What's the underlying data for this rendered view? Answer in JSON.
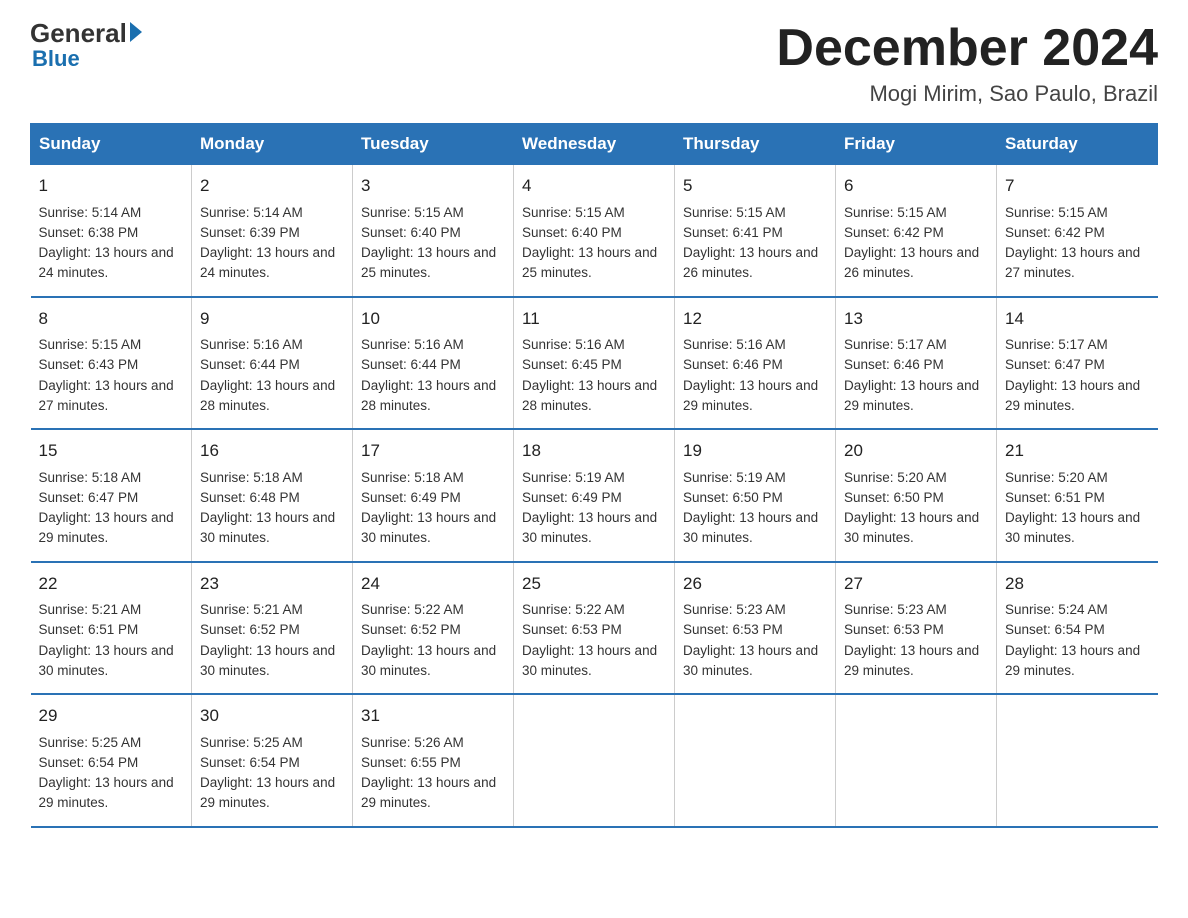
{
  "header": {
    "logo": {
      "general": "General",
      "blue": "Blue",
      "tagline": "Blue"
    },
    "title": "December 2024",
    "subtitle": "Mogi Mirim, Sao Paulo, Brazil"
  },
  "columns": [
    "Sunday",
    "Monday",
    "Tuesday",
    "Wednesday",
    "Thursday",
    "Friday",
    "Saturday"
  ],
  "weeks": [
    [
      {
        "day": "1",
        "sunrise": "5:14 AM",
        "sunset": "6:38 PM",
        "daylight": "13 hours and 24 minutes."
      },
      {
        "day": "2",
        "sunrise": "5:14 AM",
        "sunset": "6:39 PM",
        "daylight": "13 hours and 24 minutes."
      },
      {
        "day": "3",
        "sunrise": "5:15 AM",
        "sunset": "6:40 PM",
        "daylight": "13 hours and 25 minutes."
      },
      {
        "day": "4",
        "sunrise": "5:15 AM",
        "sunset": "6:40 PM",
        "daylight": "13 hours and 25 minutes."
      },
      {
        "day": "5",
        "sunrise": "5:15 AM",
        "sunset": "6:41 PM",
        "daylight": "13 hours and 26 minutes."
      },
      {
        "day": "6",
        "sunrise": "5:15 AM",
        "sunset": "6:42 PM",
        "daylight": "13 hours and 26 minutes."
      },
      {
        "day": "7",
        "sunrise": "5:15 AM",
        "sunset": "6:42 PM",
        "daylight": "13 hours and 27 minutes."
      }
    ],
    [
      {
        "day": "8",
        "sunrise": "5:15 AM",
        "sunset": "6:43 PM",
        "daylight": "13 hours and 27 minutes."
      },
      {
        "day": "9",
        "sunrise": "5:16 AM",
        "sunset": "6:44 PM",
        "daylight": "13 hours and 28 minutes."
      },
      {
        "day": "10",
        "sunrise": "5:16 AM",
        "sunset": "6:44 PM",
        "daylight": "13 hours and 28 minutes."
      },
      {
        "day": "11",
        "sunrise": "5:16 AM",
        "sunset": "6:45 PM",
        "daylight": "13 hours and 28 minutes."
      },
      {
        "day": "12",
        "sunrise": "5:16 AM",
        "sunset": "6:46 PM",
        "daylight": "13 hours and 29 minutes."
      },
      {
        "day": "13",
        "sunrise": "5:17 AM",
        "sunset": "6:46 PM",
        "daylight": "13 hours and 29 minutes."
      },
      {
        "day": "14",
        "sunrise": "5:17 AM",
        "sunset": "6:47 PM",
        "daylight": "13 hours and 29 minutes."
      }
    ],
    [
      {
        "day": "15",
        "sunrise": "5:18 AM",
        "sunset": "6:47 PM",
        "daylight": "13 hours and 29 minutes."
      },
      {
        "day": "16",
        "sunrise": "5:18 AM",
        "sunset": "6:48 PM",
        "daylight": "13 hours and 30 minutes."
      },
      {
        "day": "17",
        "sunrise": "5:18 AM",
        "sunset": "6:49 PM",
        "daylight": "13 hours and 30 minutes."
      },
      {
        "day": "18",
        "sunrise": "5:19 AM",
        "sunset": "6:49 PM",
        "daylight": "13 hours and 30 minutes."
      },
      {
        "day": "19",
        "sunrise": "5:19 AM",
        "sunset": "6:50 PM",
        "daylight": "13 hours and 30 minutes."
      },
      {
        "day": "20",
        "sunrise": "5:20 AM",
        "sunset": "6:50 PM",
        "daylight": "13 hours and 30 minutes."
      },
      {
        "day": "21",
        "sunrise": "5:20 AM",
        "sunset": "6:51 PM",
        "daylight": "13 hours and 30 minutes."
      }
    ],
    [
      {
        "day": "22",
        "sunrise": "5:21 AM",
        "sunset": "6:51 PM",
        "daylight": "13 hours and 30 minutes."
      },
      {
        "day": "23",
        "sunrise": "5:21 AM",
        "sunset": "6:52 PM",
        "daylight": "13 hours and 30 minutes."
      },
      {
        "day": "24",
        "sunrise": "5:22 AM",
        "sunset": "6:52 PM",
        "daylight": "13 hours and 30 minutes."
      },
      {
        "day": "25",
        "sunrise": "5:22 AM",
        "sunset": "6:53 PM",
        "daylight": "13 hours and 30 minutes."
      },
      {
        "day": "26",
        "sunrise": "5:23 AM",
        "sunset": "6:53 PM",
        "daylight": "13 hours and 30 minutes."
      },
      {
        "day": "27",
        "sunrise": "5:23 AM",
        "sunset": "6:53 PM",
        "daylight": "13 hours and 29 minutes."
      },
      {
        "day": "28",
        "sunrise": "5:24 AM",
        "sunset": "6:54 PM",
        "daylight": "13 hours and 29 minutes."
      }
    ],
    [
      {
        "day": "29",
        "sunrise": "5:25 AM",
        "sunset": "6:54 PM",
        "daylight": "13 hours and 29 minutes."
      },
      {
        "day": "30",
        "sunrise": "5:25 AM",
        "sunset": "6:54 PM",
        "daylight": "13 hours and 29 minutes."
      },
      {
        "day": "31",
        "sunrise": "5:26 AM",
        "sunset": "6:55 PM",
        "daylight": "13 hours and 29 minutes."
      },
      null,
      null,
      null,
      null
    ]
  ]
}
